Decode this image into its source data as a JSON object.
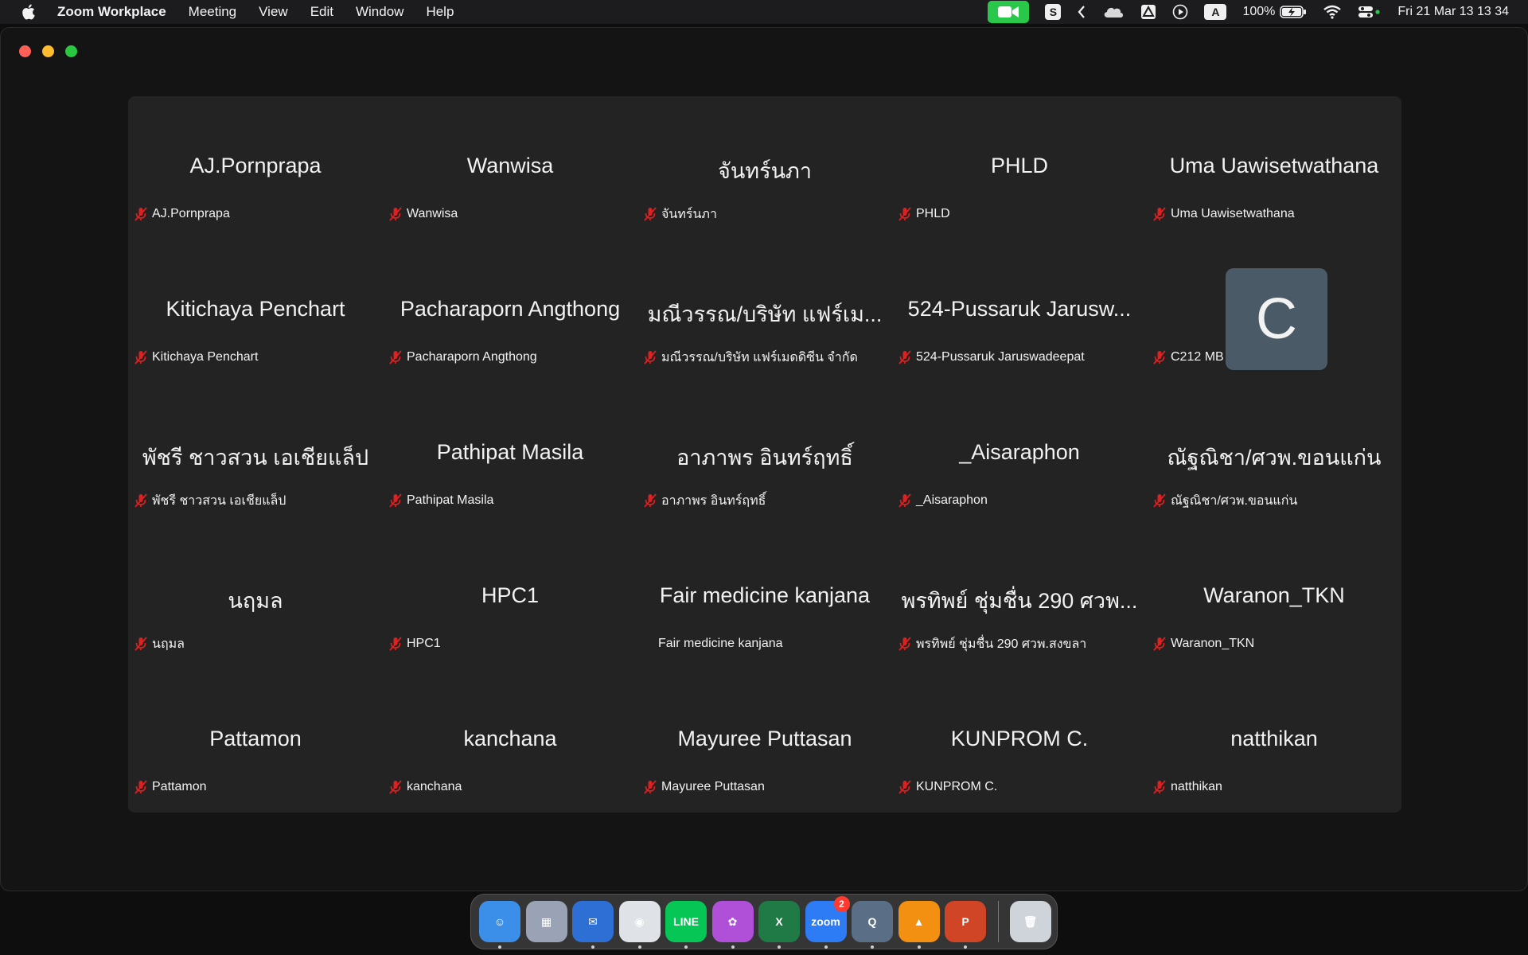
{
  "menubar": {
    "app_name": "Zoom Workplace",
    "menus": [
      "Meeting",
      "View",
      "Edit",
      "Window",
      "Help"
    ],
    "battery": "100%",
    "datetime": "Fri 21 Mar  13 13 34",
    "status_letters": {
      "s": "S",
      "a": "A"
    }
  },
  "participants": [
    {
      "display": "AJ.Pornprapa",
      "label": "AJ.Pornprapa",
      "muted": true
    },
    {
      "display": "Wanwisa",
      "label": "Wanwisa",
      "muted": true
    },
    {
      "display": "จันทร์นภา",
      "label": "จันทร์นภา",
      "muted": true
    },
    {
      "display": "PHLD",
      "label": "PHLD",
      "muted": true
    },
    {
      "display": "Uma Uawisetwathana",
      "label": "Uma Uawisetwathana",
      "muted": true
    },
    {
      "display": "Kitichaya Penchart",
      "label": "Kitichaya Penchart",
      "muted": true
    },
    {
      "display": "Pacharaporn Angthong",
      "label": "Pacharaporn Angthong",
      "muted": true
    },
    {
      "display": "มณีวรรณ/บริษัท แฟร์เม...",
      "label": "มณีวรรณ/บริษัท แฟร์เมดดิซีน จำกัด",
      "muted": true
    },
    {
      "display": "524-Pussaruk Jarusw...",
      "label": "524-Pussaruk Jaruswadeepat",
      "muted": true
    },
    {
      "display": "C",
      "label": "C212 MB",
      "muted": true,
      "avatar": true
    },
    {
      "display": "พัชรี ชาวสวน เอเชียแล็ป",
      "label": "พัชรี ชาวสวน เอเชียแล็ป",
      "muted": true
    },
    {
      "display": "Pathipat Masila",
      "label": "Pathipat Masila",
      "muted": true
    },
    {
      "display": "อาภาพร อินทร์ฤทธิ์",
      "label": "อาภาพร อินทร์ฤทธิ์",
      "muted": true
    },
    {
      "display": "_Aisaraphon",
      "label": "_Aisaraphon",
      "muted": true
    },
    {
      "display": "ณัฐณิชา/ศวพ.ขอนแก่น",
      "label": "ณัฐณิชา/ศวพ.ขอนแก่น",
      "muted": true
    },
    {
      "display": "นฤมล",
      "label": "นฤมล",
      "muted": true
    },
    {
      "display": "HPC1",
      "label": "HPC1",
      "muted": true
    },
    {
      "display": "Fair medicine kanjana",
      "label": "Fair medicine kanjana",
      "muted": false
    },
    {
      "display": "พรทิพย์ ชุ่มชื่น 290 ศวพ...",
      "label": "พรทิพย์ ชุ่มชื่น 290 ศวพ.สงขลา",
      "muted": true
    },
    {
      "display": "Waranon_TKN",
      "label": "Waranon_TKN",
      "muted": true
    },
    {
      "display": "Pattamon",
      "label": "Pattamon",
      "muted": true
    },
    {
      "display": "kanchana",
      "label": "kanchana",
      "muted": true
    },
    {
      "display": "Mayuree Puttasan",
      "label": "Mayuree Puttasan",
      "muted": true
    },
    {
      "display": "KUNPROM C.",
      "label": "KUNPROM C.",
      "muted": true
    },
    {
      "display": "natthikan",
      "label": "natthikan",
      "muted": true
    }
  ],
  "dock": {
    "apps": [
      {
        "name": "finder",
        "color": "#3b8fe8",
        "glyph": "☺",
        "running": true
      },
      {
        "name": "launchpad",
        "color": "#9aa3b5",
        "glyph": "▦",
        "running": false
      },
      {
        "name": "thunderbird",
        "color": "#2e6fd6",
        "glyph": "✉",
        "running": true
      },
      {
        "name": "chrome",
        "color": "#dfe3e8",
        "glyph": "◉",
        "running": true
      },
      {
        "name": "line",
        "color": "#06c755",
        "glyph": "LINE",
        "running": true
      },
      {
        "name": "flower-app",
        "color": "#b04fd8",
        "glyph": "✿",
        "running": true
      },
      {
        "name": "excel",
        "color": "#1f7a45",
        "glyph": "X",
        "running": true
      },
      {
        "name": "zoom",
        "color": "#2d7cf6",
        "glyph": "zoom",
        "running": true,
        "badge": "2"
      },
      {
        "name": "quicktime",
        "color": "#5a6f86",
        "glyph": "Q",
        "running": true
      },
      {
        "name": "vlc",
        "color": "#f39012",
        "glyph": "▲",
        "running": true
      },
      {
        "name": "powerpoint",
        "color": "#d04525",
        "glyph": "P",
        "running": true
      }
    ],
    "trash": {
      "name": "trash",
      "color": "#cfd4da",
      "glyph": "🗑"
    }
  }
}
